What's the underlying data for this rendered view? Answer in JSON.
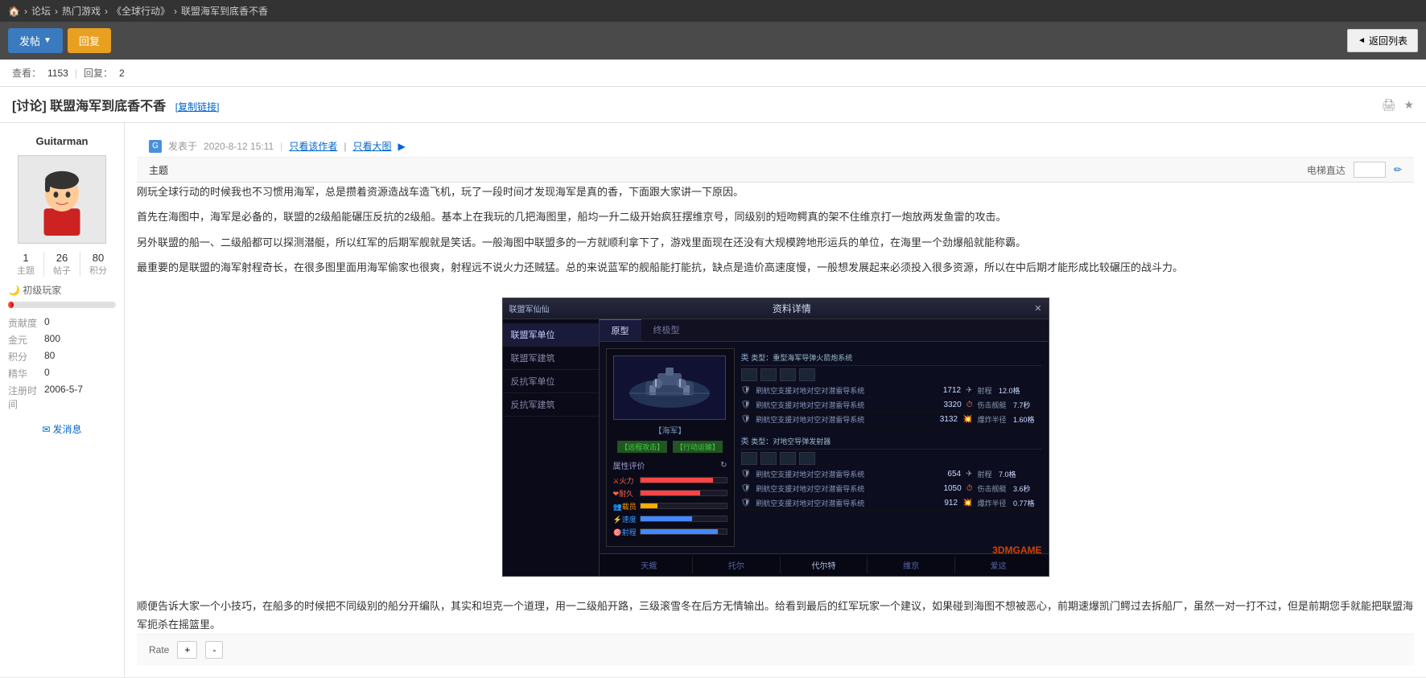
{
  "nav": {
    "home_icon": "🏠",
    "breadcrumbs": [
      "论坛",
      "热门游戏",
      "《全球行动》",
      "联盟海军到底香不香"
    ],
    "separators": [
      "›",
      "›",
      "›"
    ]
  },
  "toolbar": {
    "post_button": "发帖",
    "reply_button": "回复",
    "return_button": "返回列表"
  },
  "thread": {
    "views_label": "查看：",
    "views_count": "1153",
    "replies_label": "回复：",
    "replies_count": "2",
    "title": "[讨论] 联盟海军到底香不香",
    "tag": "[复制链接]",
    "topic_label": "主题",
    "elevator_label": "电梯直达"
  },
  "post": {
    "posted_by": "发表于",
    "date": "2020-8-12 15:11",
    "view_options": [
      "只看该作者",
      "只看大图"
    ],
    "author": "Guitarman",
    "stats": {
      "posts_label": "主题",
      "posts_count": "1",
      "threads_label": "帖子",
      "threads_count": "26",
      "points_label": "积分",
      "points_count": "80"
    },
    "level": "初级玩家",
    "level_icon": "🌙",
    "user_info": {
      "contribution_label": "贡献度",
      "contribution_val": "0",
      "gold_label": "金元",
      "gold_val": "800",
      "points_label": "积分",
      "points_val": "80",
      "essence_label": "精华",
      "essence_val": "0",
      "reg_label": "注册时间",
      "reg_val": "2006-5-7"
    },
    "send_msg": "发消息",
    "content": {
      "para1": "刚玩全球行动的时候我也不习惯用海军，总是攒着资源造战车造飞机，玩了一段时间才发现海军是真的香，下面跟大家讲一下原因。",
      "para2": "首先在海图中，海军是必备的，联盟的2级船能碾压反抗的2级船。基本上在我玩的几把海图里，船均一升二级开始疯狂摆维京号，同级别的短吻鳄真的架不住维京打一炮放两发鱼雷的攻击。",
      "para3": "另外联盟的船一、二级船都可以探测潜艇，所以红军的后期军舰就是笑话。一般海图中联盟多的一方就顺利拿下了，游戏里面现在还没有大规模跨地形运兵的单位，在海里一个劲爆船就能称霸。",
      "para4": "最重要的是联盟的海军射程奇长，在很多图里面用海军偷家也很爽，射程远不说火力还贼猛。总的来说蓝军的舰船能打能抗，缺点是造价高速度慢，一般想发展起来必须投入很多资源，所以在中后期才能形成比较碾压的战斗力。",
      "para5": "顺便告诉大家一个小技巧，在船多的时候把不同级别的船分开编队，其实和坦克一个道理，用一二级船开路，三级滚雪冬在后方无情输出。给看到最后的红军玩家一个建议，如果碰到海图不想被恶心，前期速爆凯门鳄过去拆船厂，虽然一对一打不过，但是前期您手就能把联盟海军扼杀在摇篮里。"
    }
  },
  "screenshot": {
    "header_title": "资料详情",
    "close": "✕",
    "left_menu": [
      "联盟军单位",
      "联盟军建筑",
      "反抗军单位",
      "反抗军建筑"
    ],
    "tabs": [
      "原型",
      "终极型"
    ],
    "unit_type_label": "【海军】",
    "unit_action1": "【远程攻击】",
    "unit_action2": "【行动运输】",
    "attr_label": "属性评价",
    "attrs": [
      "火力",
      "耐久",
      "载员",
      "速度",
      "射程"
    ],
    "attr_fills": [
      85,
      70,
      20,
      60,
      90
    ],
    "weapon_type1": "类型：重型海军导弹火箭炮系统",
    "weapon_type2": "类型：对地空导弹发射器",
    "weapons1": [
      {
        "name": "刷航空支援对地对空对潜雷导系统",
        "val": "1712",
        "stat_label": "射程",
        "stat_val": "12.0格"
      },
      {
        "name": "刷航空支援对地对空对潜雷导系统",
        "val": "3320",
        "stat_label": "伤击舰艇",
        "stat_val": "7.7秒"
      },
      {
        "name": "刷航空支援对地对空对潜雷导系统",
        "val": "3132",
        "stat_label": "爆炸半径",
        "stat_val": "1.60格"
      }
    ],
    "weapons2": [
      {
        "name": "刷航空支援对地对空对潜雷导系统",
        "val": "654",
        "stat_label": "射程",
        "stat_val": "7.0格"
      },
      {
        "name": "刷航空支援对地对空对潜雷导系统",
        "val": "1050",
        "stat_label": "伤击舰艇",
        "stat_val": "3.6秒"
      },
      {
        "name": "刷航空支援对地对空对潜雷导系统",
        "val": "912",
        "stat_label": "爆炸半径",
        "stat_val": "0.77格"
      }
    ],
    "bottom_tabs": [
      "天蛾",
      "托尔",
      "代尔特",
      "维京",
      "爱这"
    ],
    "watermark": "3DMGAME"
  },
  "rate": {
    "label": "Rate"
  }
}
